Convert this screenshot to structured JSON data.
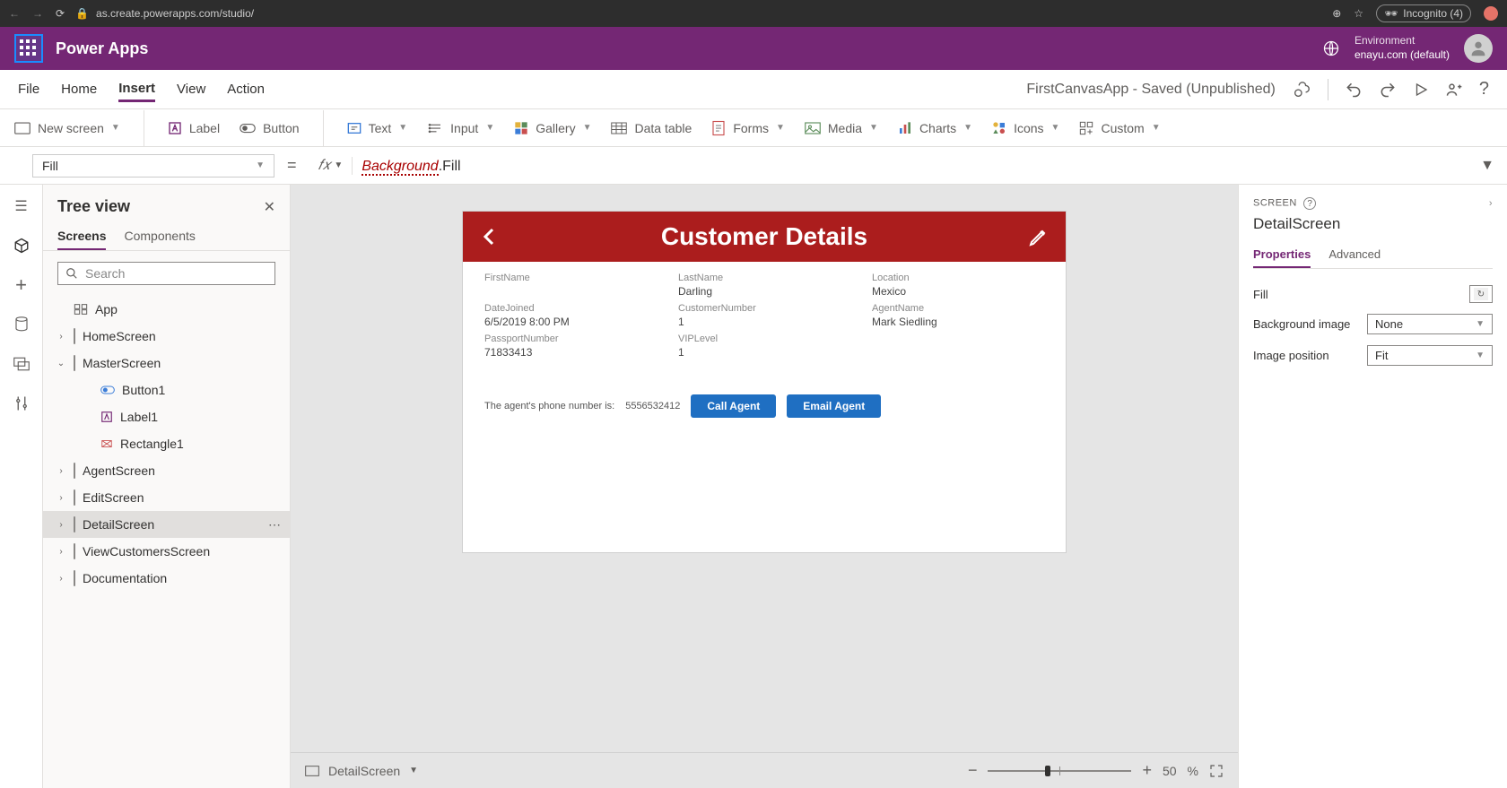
{
  "browser": {
    "url": "as.create.powerapps.com/studio/",
    "incognito": "Incognito (4)"
  },
  "header": {
    "app_name": "Power Apps",
    "env_label": "Environment",
    "env_value": "enayu.com (default)"
  },
  "menu": {
    "items": [
      "File",
      "Home",
      "Insert",
      "View",
      "Action"
    ],
    "active_index": 2,
    "status": "FirstCanvasApp - Saved (Unpublished)"
  },
  "ribbon": {
    "new_screen": "New screen",
    "label": "Label",
    "button": "Button",
    "text": "Text",
    "input": "Input",
    "gallery": "Gallery",
    "data_table": "Data table",
    "forms": "Forms",
    "media": "Media",
    "charts": "Charts",
    "icons": "Icons",
    "custom": "Custom"
  },
  "formula": {
    "property": "Fill",
    "err_token": "Background",
    "rest": ".Fill"
  },
  "tree": {
    "title": "Tree view",
    "tabs": [
      "Screens",
      "Components"
    ],
    "active_tab": 0,
    "search_placeholder": "Search",
    "items": [
      {
        "label": "App",
        "kind": "app"
      },
      {
        "label": "HomeScreen",
        "kind": "screen",
        "expandable": true
      },
      {
        "label": "MasterScreen",
        "kind": "screen",
        "expandable": true,
        "expanded": true
      },
      {
        "label": "Button1",
        "kind": "button",
        "child": true
      },
      {
        "label": "Label1",
        "kind": "label",
        "child": true
      },
      {
        "label": "Rectangle1",
        "kind": "rect",
        "child": true
      },
      {
        "label": "AgentScreen",
        "kind": "screen",
        "expandable": true
      },
      {
        "label": "EditScreen",
        "kind": "screen",
        "expandable": true
      },
      {
        "label": "DetailScreen",
        "kind": "screen",
        "expandable": true,
        "selected": true
      },
      {
        "label": "ViewCustomersScreen",
        "kind": "screen",
        "expandable": true
      },
      {
        "label": "Documentation",
        "kind": "screen",
        "expandable": true
      }
    ]
  },
  "canvas": {
    "header": "Customer Details",
    "fields": [
      {
        "lbl": "FirstName",
        "val": ""
      },
      {
        "lbl": "LastName",
        "val": "Darling"
      },
      {
        "lbl": "Location",
        "val": "Mexico"
      },
      {
        "lbl": "DateJoined",
        "val": "6/5/2019 8:00 PM"
      },
      {
        "lbl": "CustomerNumber",
        "val": "1"
      },
      {
        "lbl": "AgentName",
        "val": "Mark Siedling"
      },
      {
        "lbl": "PassportNumber",
        "val": "71833413"
      },
      {
        "lbl": "VIPLevel",
        "val": "1"
      }
    ],
    "agent_text": "The agent's phone number is:",
    "agent_phone": "5556532412",
    "btn_call": "Call Agent",
    "btn_email": "Email Agent",
    "status_name": "DetailScreen",
    "zoom_pct": "50",
    "zoom_unit": "%"
  },
  "properties": {
    "section": "SCREEN",
    "name": "DetailScreen",
    "tabs": [
      "Properties",
      "Advanced"
    ],
    "active_tab": 0,
    "rows": [
      {
        "label": "Fill",
        "type": "color"
      },
      {
        "label": "Background image",
        "type": "select",
        "value": "None"
      },
      {
        "label": "Image position",
        "type": "select",
        "value": "Fit"
      }
    ]
  }
}
